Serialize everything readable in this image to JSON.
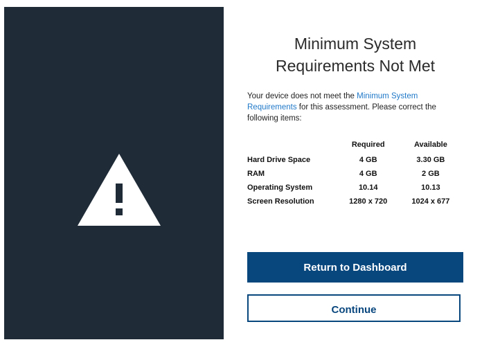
{
  "dialog": {
    "title_line1": "Minimum System",
    "title_line2": "Requirements Not Met",
    "description_prefix": "Your device does not meet the ",
    "description_link": "Minimum System Requirements",
    "description_suffix": " for this assessment.  Please correct the following items:"
  },
  "requirements": {
    "headers": [
      "",
      "Required",
      "Available"
    ],
    "rows": [
      {
        "item": "Hard Drive Space",
        "required": "4 GB",
        "available": "3.30 GB"
      },
      {
        "item": "RAM",
        "required": "4 GB",
        "available": "2 GB"
      },
      {
        "item": "Operating System",
        "required": "10.14",
        "available": "10.13"
      },
      {
        "item": "Screen Resolution",
        "required": "1280 x 720",
        "available": "1024 x 677"
      }
    ]
  },
  "buttons": {
    "return_label": "Return to Dashboard",
    "continue_label": "Continue"
  },
  "icons": {
    "left_panel_icon": "warning-icon"
  },
  "colors": {
    "left_panel_bg": "#1f2b37",
    "primary_button": "#08467e",
    "link": "#1e78c8"
  }
}
